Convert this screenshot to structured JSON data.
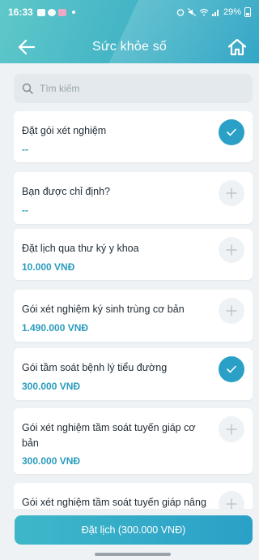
{
  "status_bar": {
    "time": "16:33",
    "battery": "29%"
  },
  "header": {
    "title": "Sức khỏe số"
  },
  "search": {
    "placeholder": "Tìm kiếm"
  },
  "items": [
    {
      "name": "Đặt gói xét nghiệm",
      "price": "--",
      "selected": true
    },
    {
      "name": "Bạn được chỉ định?",
      "price": "--",
      "selected": false
    },
    {
      "name": "Đặt lịch qua thư ký y khoa",
      "price": "10.000 VNĐ",
      "selected": false
    },
    {
      "name": "Gói xét nghiệm ký sinh trùng cơ bản",
      "price": "1.490.000 VNĐ",
      "selected": false
    },
    {
      "name": "Gói tầm soát bệnh lý tiểu đường",
      "price": "300.000 VNĐ",
      "selected": true
    },
    {
      "name": "Gói xét nghiệm tầm soát tuyến giáp cơ bản",
      "price": "300.000 VNĐ",
      "selected": false
    },
    {
      "name": "Gói xét nghiệm tầm soát tuyến giáp nâng",
      "price": "",
      "selected": false
    }
  ],
  "footer": {
    "book_label": "Đặt lịch (300.000 VNĐ)"
  },
  "colors": {
    "accent": "#2aa0c7",
    "header_start": "#5fc8c9",
    "price": "#2a9bbd"
  }
}
